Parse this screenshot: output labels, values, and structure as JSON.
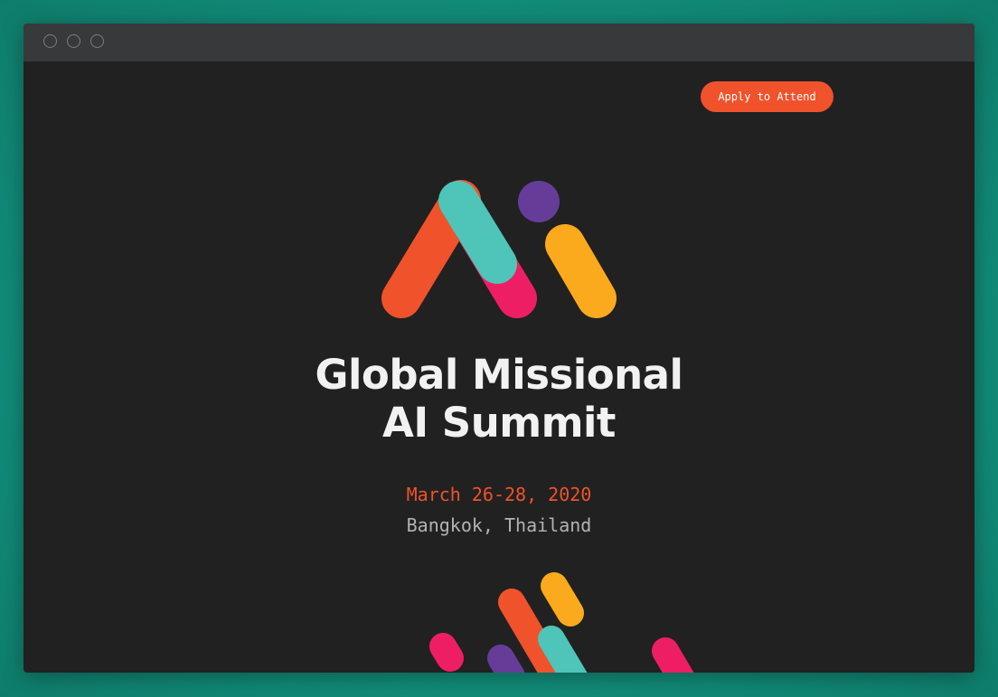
{
  "browser": {
    "window_controls": [
      "close",
      "minimize",
      "maximize"
    ]
  },
  "header": {
    "cta_label": "Apply to Attend"
  },
  "hero": {
    "title_line1": "Global Missional",
    "title_line2": "AI Summit",
    "date": "March 26-28, 2020",
    "location": "Bangkok, Thailand"
  },
  "colors": {
    "background": "#212121",
    "accent_orange": "#f0522b",
    "teal": "#4fc4b8",
    "pink": "#ee1e65",
    "purple": "#663c99",
    "yellow": "#fbaa1d",
    "title_text": "#f2f2f2",
    "location_text": "#b3b3b3"
  },
  "icons": {
    "logo": "ai-summit-logo-icon",
    "decoration": "confetti-stripes-decoration"
  }
}
